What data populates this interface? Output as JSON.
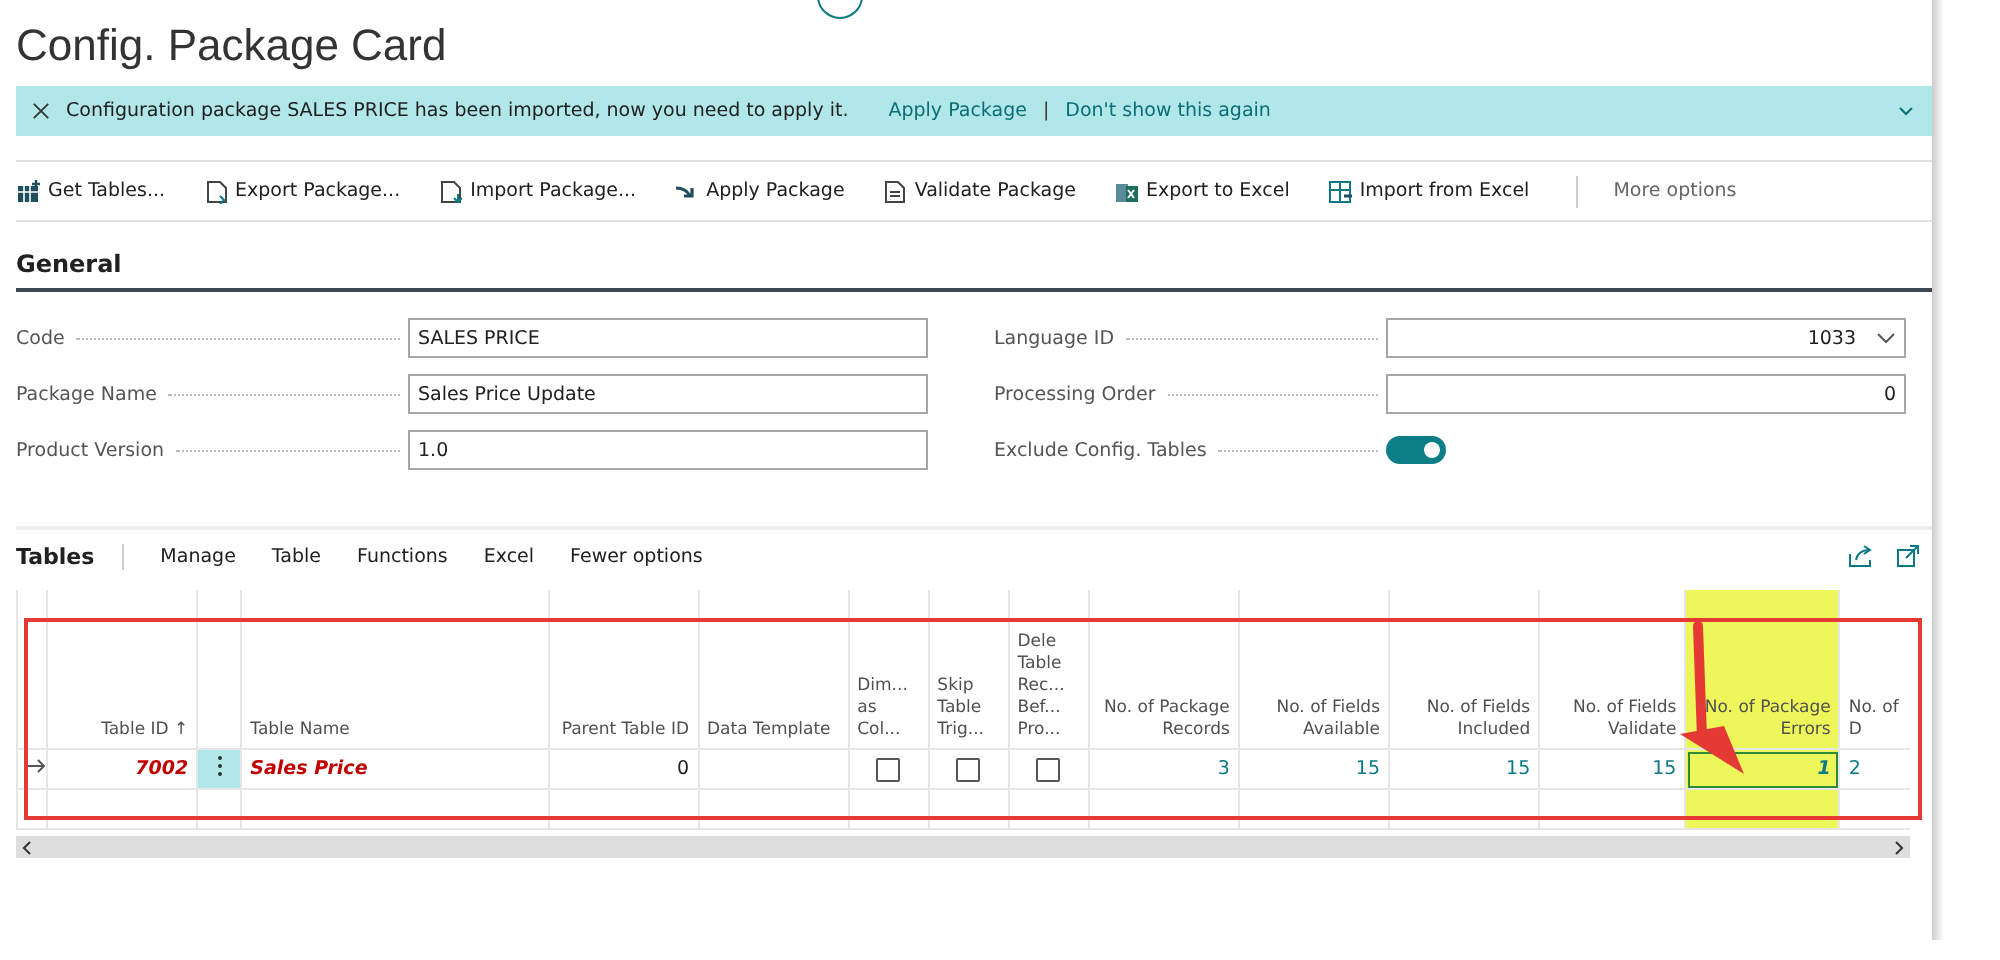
{
  "page": {
    "title": "Config. Package Card"
  },
  "notification": {
    "message": "Configuration package SALES PRICE has been imported, now you need to apply it.",
    "actions": [
      "Apply Package",
      "Don't show this again"
    ],
    "separator": "|"
  },
  "actions": [
    {
      "label": "Get Tables...",
      "kind": "table"
    },
    {
      "label": "Export Package...",
      "kind": "export"
    },
    {
      "label": "Import Package...",
      "kind": "import"
    },
    {
      "label": "Apply Package",
      "kind": "apply"
    },
    {
      "label": "Validate Package",
      "kind": "validate"
    },
    {
      "label": "Export to Excel",
      "kind": "excel-out"
    },
    {
      "label": "Import from Excel",
      "kind": "excel-in"
    }
  ],
  "more_label": "More options",
  "general": {
    "heading": "General",
    "fields": [
      {
        "label": "Code",
        "value": "SALES PRICE",
        "kind": "text"
      },
      {
        "label": "Package Name",
        "value": "Sales Price Update",
        "kind": "text"
      },
      {
        "label": "Product Version",
        "value": "1.0",
        "kind": "text"
      },
      {
        "label": "Language ID",
        "value": "1033",
        "kind": "dropdown"
      },
      {
        "label": "Processing Order",
        "value": "0",
        "kind": "number"
      },
      {
        "label": "Exclude Config. Tables",
        "on": true,
        "kind": "toggle"
      }
    ]
  },
  "tables": {
    "heading": "Tables",
    "menu": [
      "Manage",
      "Table",
      "Functions",
      "Excel"
    ],
    "less_label": "Fewer options",
    "columns": [
      {
        "kind": "marker",
        "highlighted": false
      },
      {
        "label": "Table ID ↑",
        "kind": "number",
        "highlighted": false
      },
      {
        "kind": "menu",
        "highlighted": false
      },
      {
        "label": "Table Name",
        "kind": "text",
        "highlighted": false
      },
      {
        "label": "Parent Table ID",
        "kind": "number",
        "highlighted": false
      },
      {
        "label": "Data Template",
        "kind": "text",
        "highlighted": false
      },
      {
        "label": "Dim... as Col...",
        "kind": "check",
        "highlighted": false
      },
      {
        "label": "Skip Table Trig...",
        "kind": "check",
        "highlighted": false
      },
      {
        "label": "Dele Table Rec... Bef... Pro...",
        "kind": "check",
        "highlighted": false
      },
      {
        "label": "No. of Package Records",
        "kind": "number",
        "highlighted": false
      },
      {
        "label": "No. of Fields Available",
        "kind": "number",
        "highlighted": false
      },
      {
        "label": "No. of Fields Included",
        "kind": "number",
        "highlighted": false
      },
      {
        "label": "No. of Fields Validate",
        "kind": "number",
        "highlighted": false
      },
      {
        "label": "No. of Package Errors",
        "kind": "number",
        "highlighted": true
      },
      {
        "label": "No. of D",
        "kind": "text",
        "highlighted": false
      }
    ],
    "rows": [
      {
        "current": true,
        "cells": [
          {
            "kind": "text",
            "text": "7002",
            "error": true,
            "focused": false
          },
          {
            "kind": "text",
            "text": "Sales Price",
            "error": true,
            "focused": false
          },
          {
            "kind": "text",
            "text": "0",
            "error": false,
            "focused": false
          },
          {
            "kind": "empty",
            "focused": false
          },
          {
            "kind": "check",
            "checked": false,
            "focused": false
          },
          {
            "kind": "check",
            "checked": false,
            "focused": false
          },
          {
            "kind": "check",
            "checked": false,
            "focused": false
          },
          {
            "kind": "link",
            "text": "3",
            "error": false,
            "focused": false
          },
          {
            "kind": "link",
            "text": "15",
            "error": false,
            "focused": false
          },
          {
            "kind": "link",
            "text": "15",
            "error": false,
            "focused": false
          },
          {
            "kind": "link",
            "text": "15",
            "error": false,
            "focused": false
          },
          {
            "kind": "link",
            "text": "1",
            "error": true,
            "focused": true
          },
          {
            "kind": "link",
            "text": "2",
            "error": false,
            "focused": false
          }
        ]
      },
      {
        "current": false
      }
    ],
    "annotations": {
      "frame": true,
      "arrow": true
    }
  }
}
